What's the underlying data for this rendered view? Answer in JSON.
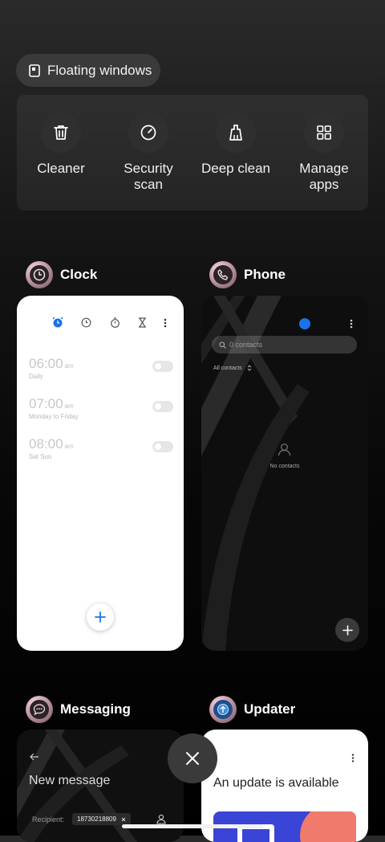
{
  "floating": {
    "label": "Floating windows"
  },
  "tools": [
    {
      "label": "Cleaner",
      "icon": "trash-icon"
    },
    {
      "label": "Security scan",
      "line1": "Security",
      "line2": "scan",
      "icon": "scan-icon"
    },
    {
      "label": "Deep clean",
      "icon": "deep-clean-icon"
    },
    {
      "label": "Manage apps",
      "line1": "Manage",
      "line2": "apps",
      "icon": "grid-icon"
    }
  ],
  "apps": {
    "clock": {
      "title": "Clock",
      "alarms": [
        {
          "time": "06:00",
          "period": "am",
          "repeat": "Daily"
        },
        {
          "time": "07:00",
          "period": "am",
          "repeat": "Monday to Friday"
        },
        {
          "time": "08:00",
          "period": "am",
          "repeat": "Sat Sun"
        }
      ]
    },
    "phone": {
      "title": "Phone",
      "search_placeholder": "0 contacts",
      "filter": "All contacts",
      "empty": "No contacts"
    },
    "messaging": {
      "title": "Messaging",
      "heading": "New message",
      "recipient_label": "Recipient:",
      "recipient_value": "18730218809"
    },
    "updater": {
      "title": "Updater",
      "heading": "An update is available"
    }
  },
  "colors": {
    "accent_blue": "#1a73e8",
    "background": "#000000",
    "pill": "#3a3a3a"
  }
}
